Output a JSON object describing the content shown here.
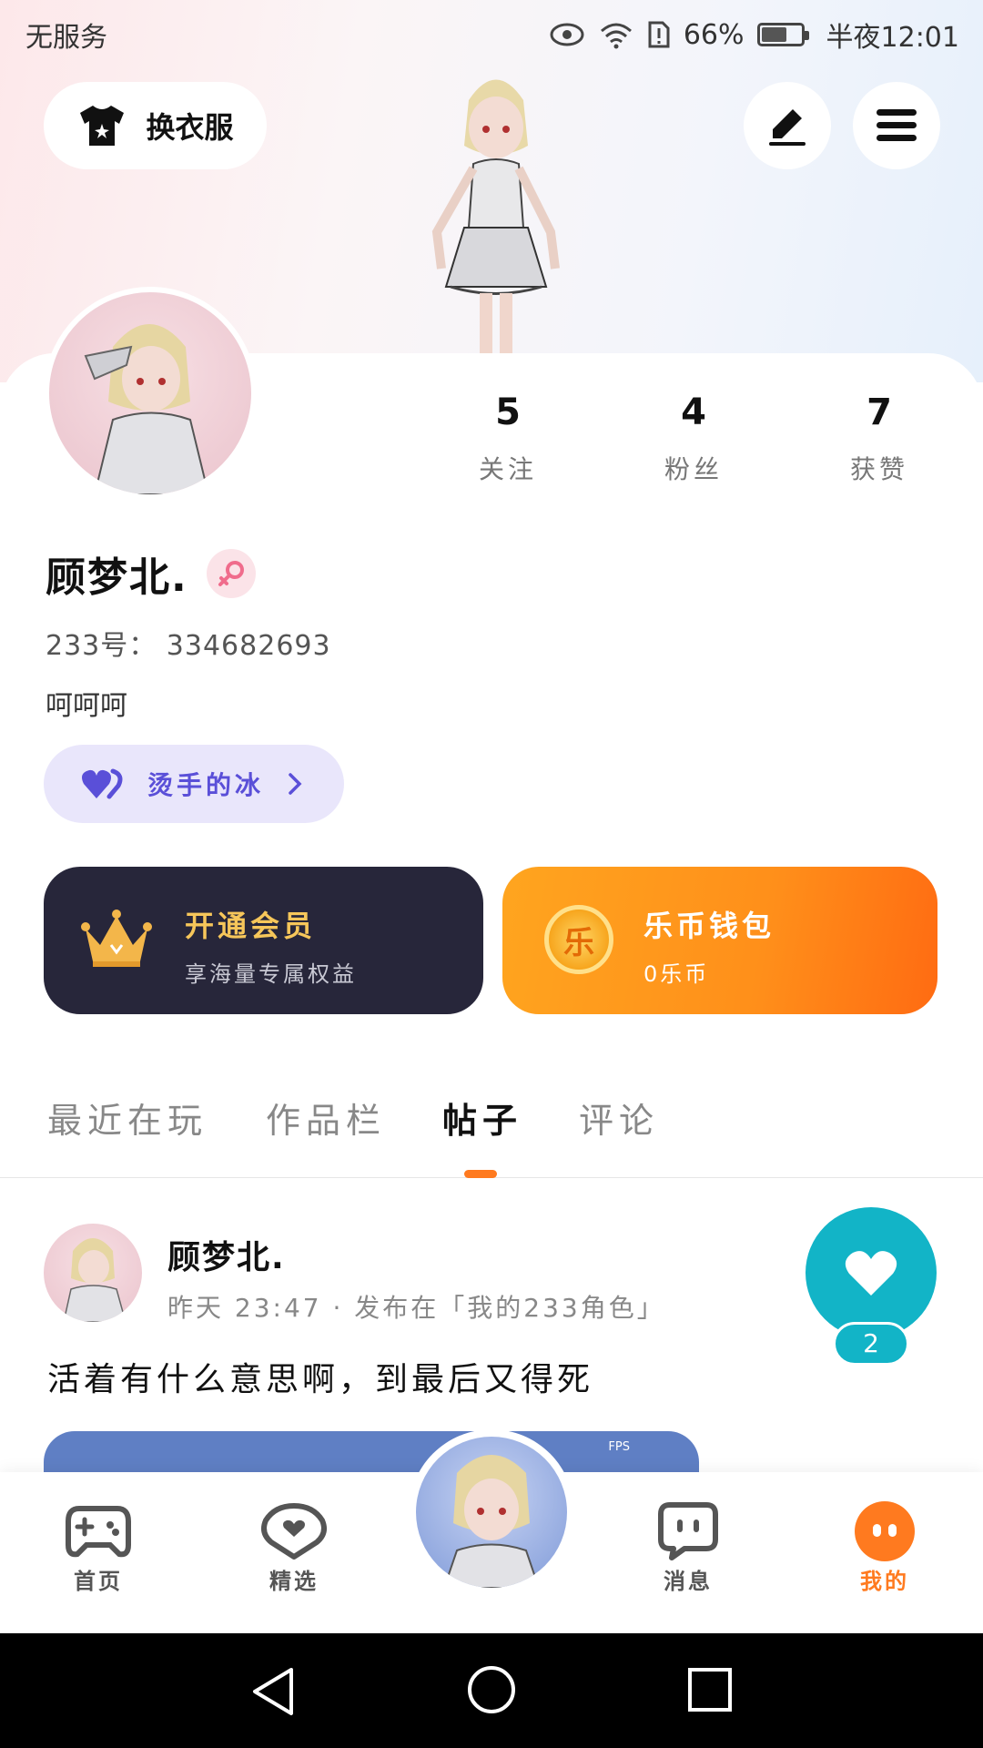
{
  "status_bar": {
    "carrier": "无服务",
    "battery": "66%",
    "battery_level": 0.66,
    "time": "半夜12:01"
  },
  "header": {
    "dress_label": "换衣服",
    "edit_icon": "pencil-icon",
    "menu_icon": "hamburger-menu-icon"
  },
  "profile": {
    "stats": [
      {
        "value": "5",
        "label": "关注"
      },
      {
        "value": "4",
        "label": "粉丝"
      },
      {
        "value": "7",
        "label": "获赞"
      }
    ],
    "name": "顾梦北.",
    "gender_icon": "female-icon",
    "uid": "233号： 334682693",
    "bio": "呵呵呵",
    "guard_label": "烫手的冰"
  },
  "promos": {
    "vip_title": "开通会员",
    "vip_sub": "享海量专属权益",
    "coin_title": "乐币钱包",
    "coin_sub": "0乐币",
    "coin_badge": "乐",
    "vip_color": "#27263a",
    "coin_color": "#ff8f1a"
  },
  "tabs": [
    {
      "label": "最近在玩",
      "active": false
    },
    {
      "label": "作品栏",
      "active": false
    },
    {
      "label": "帖子",
      "active": true
    },
    {
      "label": "评论",
      "active": false
    }
  ],
  "post": {
    "author": "顾梦北.",
    "meta": "昨天 23:47 · 发布在「我的233角色」",
    "text": "活着有什么意思啊，到最后又得死",
    "likes": "2",
    "image_overlay": "FPS"
  },
  "bottom_nav": [
    {
      "label": "首页",
      "icon": "gamepad-icon"
    },
    {
      "label": "精选",
      "icon": "heart-bubble-icon"
    },
    {
      "label": "消息",
      "icon": "chat-icon"
    },
    {
      "label": "我的",
      "icon": "profile-face-icon",
      "active": true
    }
  ],
  "colors": {
    "accent": "#ff7a1f",
    "like": "#12b4c7",
    "guard_text": "#5a4fd8"
  }
}
